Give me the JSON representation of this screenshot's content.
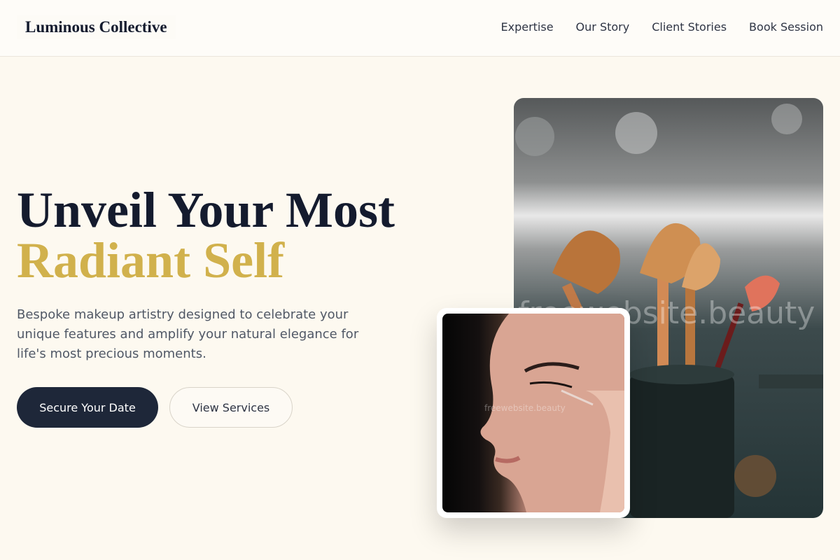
{
  "brand": {
    "name": "Luminous Collective"
  },
  "nav": {
    "items": [
      {
        "label": "Expertise"
      },
      {
        "label": "Our Story"
      },
      {
        "label": "Client Stories"
      },
      {
        "label": "Book Session"
      }
    ]
  },
  "hero": {
    "title_line1": "Unveil Your Most",
    "title_line2": "Radiant Self",
    "subtitle": "Bespoke makeup artistry designed to celebrate your unique features and amplify your natural elegance for life's most precious moments.",
    "primary_button": "Secure Your Date",
    "secondary_button": "View Services"
  },
  "images": {
    "watermark_main": "freewebsite.beauty",
    "watermark_small": "freewebsite.beauty"
  },
  "colors": {
    "accent_gold": "#d1b14c",
    "navy": "#1e2739",
    "background": "#fdf9f0"
  }
}
